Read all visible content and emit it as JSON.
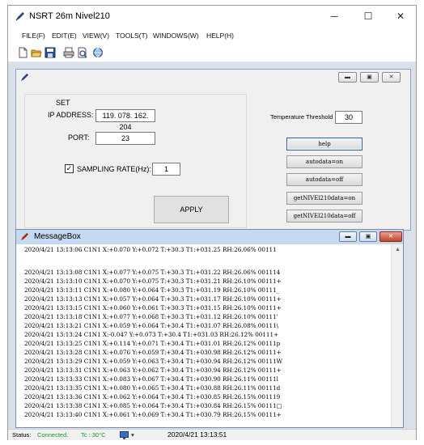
{
  "window": {
    "title": "NSRT 26m  Nivel210",
    "controls": {
      "minimize": "─",
      "maximize": "☐",
      "close": "✕"
    }
  },
  "menu": [
    "FILE(F)",
    "EDIT(E)",
    "VIEW(V)",
    "TOOLS(T)",
    "WINDOWS(W)",
    "HELP(H)"
  ],
  "toolbar_icons": [
    "new-file-icon",
    "open-folder-icon",
    "save-icon",
    "print-icon",
    "print-preview-icon",
    "globe-icon"
  ],
  "config": {
    "set_label": "SET",
    "ip_label": "IP ADDRESS:",
    "ip_value": "119. 078. 162. 204",
    "port_label": "PORT:",
    "port_value": "23",
    "sampling_label": "SAMPLING RATE(Hz):",
    "sampling_checked": true,
    "sampling_value": "1",
    "apply_label": "APPLY",
    "threshold_label": "Temperature Threshold",
    "threshold_value": "30",
    "buttons": {
      "help": "help",
      "autodata_on": "autodata=on",
      "autodata_off": "autodata=off",
      "get_on": "getNIVEl210data=on",
      "get_off": "getNIVEl210data=off"
    }
  },
  "messagebox": {
    "title": "MessageBox",
    "lines": [
      "2020/4/21 13:13:06 C1N1 X:+0.070 Y:+0.072 T:+30.3 T1:+031.25 RH:26.06% 00111",
      "",
      "2020/4/21 13:13:08 C1N1 X:+0.077 Y:+0.075 T:+30.3 T1:+031.22 RH:26.06% 001114",
      "2020/4/21 13:13:10 C1N1 X:+0.070 Y:+0.075 T:+30.3 T1:+031.21 RH:26.10% 00111+",
      "2020/4/21 13:13:11 C1N1 X:+0.080 Y:+0.064 T:+30.3 T1:+031.19 RH:26.10% 00111_",
      "2020/4/21 13:13:13 C1N1 X:+0.057 Y:+0.064 T:+30.3 T1:+031.17 RH:26.10% 00111+",
      "2020/4/21 13:13:15 C1N1 X:+0.060 Y:+0.061 T:+30.3 T1:+031.15 RH:26.10% 00111+",
      "2020/4/21 13:13:18 C1N1 X:+0.077 Y:+0.068 T:+30.3 T1:+031.12 RH:26.10% 00111'",
      "2020/4/21 13:13:21 C1N1 X:+0.059 Y:+0.064 T:+30.4 T1:+031.07 RH:26.08% 00111\\",
      "2020/4/21 13:13:24 C1N1 X:-0.047 Y:+0.073 T:+30.4 T1:+031.03 RH:26.12% 00111+",
      "2020/4/21 13:13:25 C1N1 X:+0.114 Y:+0.071 T:+30.4 T1:+031.01 RH:26.12% 00111p",
      "2020/4/21 13:13:28 C1N1 X:+0.076 Y:+0.059 T:+30.4 T1:+030.98 RH:26.12% 00111+",
      "2020/4/21 13:13:29 C1N1 X:+0.059 Y:+0.063 T:+30.4 T1:+030.94 RH:26.12% 00111W",
      "2020/4/21 13:13:31 C1N1 X:+0.063 Y:+0.062 T:+30.4 T1:+030.94 RH:26.12% 00111+",
      "2020/4/21 13:13:33 C1N1 X:+0.083 Y:+0.067 T:+30.4 T1:+030.90 RH:26.11% 00111l",
      "2020/4/21 13:13:35 C1N1 X:+0.080 Y:+0.065 T:+30.4 T1:+030.88 RH:26.11% 00111d",
      "2020/4/21 13:13:36 C1N1 X:+0.062 Y:+0.064 T:+30.4 T1:+030.85 RH:26.15% 001119",
      "2020/4/21 13:13:38 C1N1 X:+0.085 Y:+0.064 T:+30.4 T1:+030.84 RH:26.15% 00111□",
      "2020/4/21 13:13:40 C1N1 X:+0.061 Y:+0.069 T:+30.4 T1:+030.79 RH:26.15% 00111+"
    ]
  },
  "status": {
    "label": "Status:",
    "connection": "Connected.",
    "temperature": "Tc : 30°C",
    "datetime": "2020/4/21 13:13:51"
  },
  "colors": {
    "mdi_background": "#d9e0ea",
    "messagebox_title": "#c5d9f1",
    "status_connected": "#1a9a2a",
    "close_red": "#c2452b"
  }
}
